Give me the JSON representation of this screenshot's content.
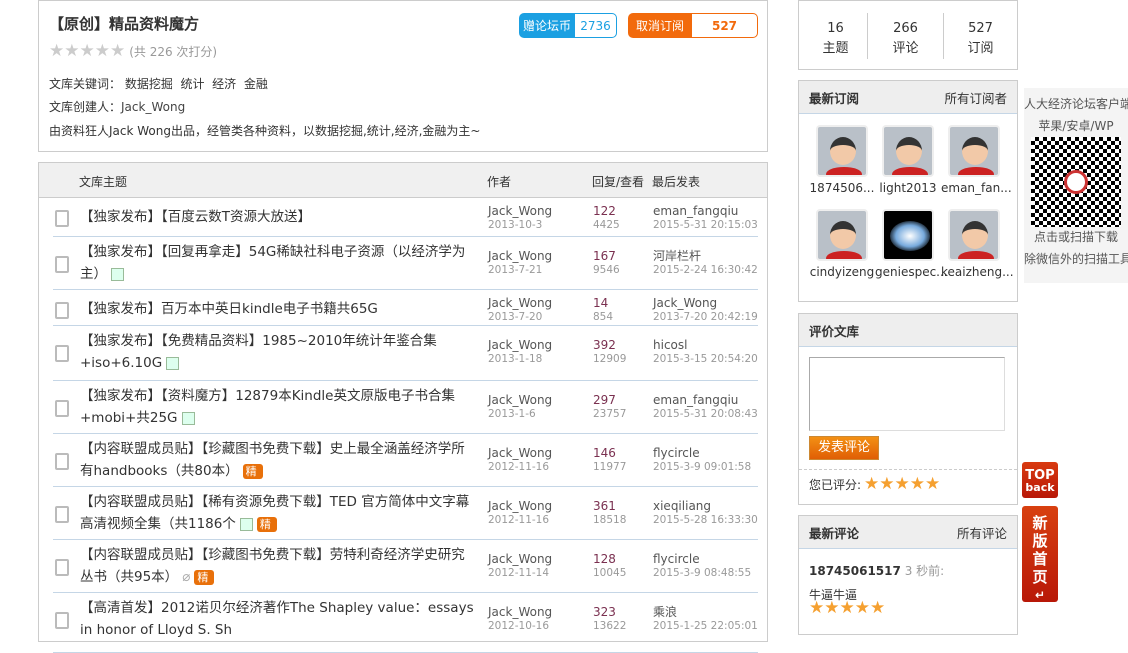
{
  "header": {
    "title": "【原创】精品资料魔方",
    "rating_count": "(共 226 次打分)",
    "keywords_label": "文库关键词：",
    "keywords": [
      "数据挖掘",
      "统计",
      "经济",
      "金融"
    ],
    "creator_label": "文库创建人：",
    "creator": "Jack_Wong",
    "description": "由资料狂人Jack Wong出品，经管类各种资料，以数据挖掘,统计,经济,金融为主~",
    "donate_label": "赠论坛币",
    "donate_count": "2736",
    "unsub_label": "取消订阅",
    "unsub_count": "527"
  },
  "table": {
    "headers": {
      "topic": "文库主题",
      "author": "作者",
      "replies": "回复/查看",
      "last": "最后发表"
    },
    "rows": [
      {
        "title": "【独家发布】【百度云数T资源大放送】",
        "author": "Jack_Wong",
        "date": "2013-10-3",
        "replies": "122",
        "views": "4425",
        "last_user": "eman_fangqiu",
        "last_time": "2015-5-31 20:15:03",
        "img": false,
        "jing": false,
        "clip": false
      },
      {
        "title": "【独家发布】【回复再拿走】54G稀缺社科电子资源（以经济学为主）",
        "author": "Jack_Wong",
        "date": "2013-7-21",
        "replies": "167",
        "views": "9546",
        "last_user": "河岸栏杆",
        "last_time": "2015-2-24 16:30:42",
        "img": true,
        "jing": false,
        "clip": false
      },
      {
        "title": "【独家发布】百万本中英日kindle电子书籍共65G",
        "author": "Jack_Wong",
        "date": "2013-7-20",
        "replies": "14",
        "views": "854",
        "last_user": "Jack_Wong",
        "last_time": "2013-7-20 20:42:19",
        "img": false,
        "jing": false,
        "clip": false
      },
      {
        "title": "【独家发布】【免费精品资料】1985~2010年统计年鉴合集+iso+6.10G",
        "author": "Jack_Wong",
        "date": "2013-1-18",
        "replies": "392",
        "views": "12909",
        "last_user": "hicosl",
        "last_time": "2015-3-15 20:54:20",
        "img": true,
        "jing": false,
        "clip": false
      },
      {
        "title": "【独家发布】【资料魔方】12879本Kindle英文原版电子书合集+mobi+共25G",
        "author": "Jack_Wong",
        "date": "2013-1-6",
        "replies": "297",
        "views": "23757",
        "last_user": "eman_fangqiu",
        "last_time": "2015-5-31 20:08:43",
        "img": true,
        "jing": false,
        "clip": false
      },
      {
        "title": "【内容联盟成员贴】【珍藏图书免费下载】史上最全涵盖经济学所有handbooks（共80本）",
        "author": "Jack_Wong",
        "date": "2012-11-16",
        "replies": "146",
        "views": "11977",
        "last_user": "flycircle",
        "last_time": "2015-3-9 09:01:58",
        "img": false,
        "jing": true,
        "clip": false
      },
      {
        "title": "【内容联盟成员贴】【稀有资源免费下载】TED 官方简体中文字幕高清视频全集（共1186个",
        "author": "Jack_Wong",
        "date": "2012-11-16",
        "replies": "361",
        "views": "18518",
        "last_user": "xieqiliang",
        "last_time": "2015-5-28 16:33:30",
        "img": true,
        "jing": true,
        "clip": false
      },
      {
        "title": "【内容联盟成员贴】【珍藏图书免费下载】劳特利奇经济学史研究丛书（共95本）",
        "author": "Jack_Wong",
        "date": "2012-11-14",
        "replies": "128",
        "views": "10045",
        "last_user": "flycircle",
        "last_time": "2015-3-9 08:48:55",
        "img": false,
        "jing": true,
        "clip": true
      },
      {
        "title": "【高清首发】2012诺贝尔经济著作The Shapley value：essays in honor of Lloyd S. Sh",
        "author": "Jack_Wong",
        "date": "2012-10-16",
        "replies": "323",
        "views": "13622",
        "last_user": "乘浪",
        "last_time": "2015-1-25 22:05:01",
        "img": false,
        "jing": false,
        "clip": false
      }
    ],
    "jing_label": "精"
  },
  "stats": [
    {
      "value": "16",
      "label": "主题"
    },
    {
      "value": "266",
      "label": "评论"
    },
    {
      "value": "527",
      "label": "订阅"
    }
  ],
  "subscribers": {
    "title": "最新订阅",
    "all_link": "所有订阅者",
    "users": [
      "1874506...",
      "light2013",
      "eman_fan...",
      "cindyizeng",
      "geniespec...",
      "keaizheng..."
    ]
  },
  "review": {
    "title": "评价文库",
    "textarea_value": "",
    "submit": "发表评论",
    "rated_label": "您已评分:",
    "rated_stars": 5
  },
  "comments": {
    "title": "最新评论",
    "all_link": "所有评论",
    "items": [
      {
        "user": "18745061517",
        "time": "3 秒前:",
        "text": "牛逼牛逼",
        "stars": 5
      }
    ]
  },
  "app_promo": {
    "line1": "人大经济论坛客户端",
    "line2": "苹果/安卓/WP",
    "line3": "点击或扫描下载",
    "line4": "除微信外的扫描工具"
  },
  "float": {
    "top_label": "TOP",
    "back_label": "back",
    "new_home": "新版首页"
  },
  "colors": {
    "blue": "#1ba0e2",
    "orange": "#f26a0c",
    "star": "#f5a030"
  }
}
